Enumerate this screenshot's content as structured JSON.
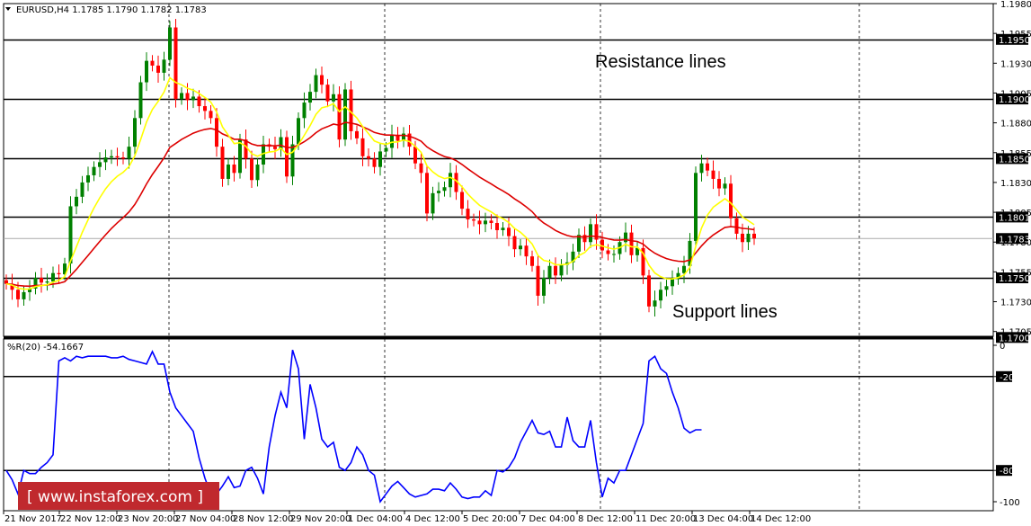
{
  "header": {
    "symbol_line": "EURUSD,H4  1.1785 1.1790 1.1782 1.1783"
  },
  "annotations": {
    "resistance": "Resistance lines",
    "support": "Support lines"
  },
  "watermark": {
    "text": "[ www.instaforex.com ]"
  },
  "colors": {
    "bull_candle": "#008000",
    "bear_candle": "#ff0000",
    "ma_fast": "#ffff00",
    "ma_slow": "#dd0000",
    "wpr_line": "#0000ff",
    "watermark_bg": "#c0292e"
  },
  "chart_data": [
    {
      "type": "candlestick",
      "title": "EURUSD,H4  1.1785 1.1790 1.1782 1.1783",
      "ylim": [
        1.1701,
        1.198
      ],
      "y_ticks": [
        1.198,
        1.1955,
        1.193,
        1.1905,
        1.188,
        1.1855,
        1.183,
        1.1805,
        1.178,
        1.1755,
        1.173,
        1.1705
      ],
      "y_tick_labels": [
        "1.1980",
        "1.1955",
        "1.1930",
        "1.1905",
        "1.1880",
        "1.1855",
        "1.1830",
        "1.1805",
        "1.1780",
        "1.1755",
        "1.1730",
        "1.1705"
      ],
      "x_tick_labels": [
        "21 Nov 2017",
        "22 Nov 12:00",
        "23 Nov 20:00",
        "27 Nov 04:00",
        "28 Nov 12:00",
        "29 Nov 20:00",
        "1 Dec 04:00",
        "4 Dec 12:00",
        "5 Dec 20:00",
        "7 Dec 04:00",
        "8 Dec 12:00",
        "11 Dec 20:00",
        "13 Dec 04:00",
        "14 Dec 12:00"
      ],
      "horizontal_lines": [
        {
          "value": 1.195,
          "label": "1.1950"
        },
        {
          "value": 1.19,
          "label": "1.1900"
        },
        {
          "value": 1.185,
          "label": "1.1850"
        },
        {
          "value": 1.1801,
          "label": "1.1801"
        },
        {
          "value": 1.175,
          "label": "1.1750"
        },
        {
          "value": 1.17,
          "label": "1.1700"
        }
      ],
      "current_price": {
        "value": 1.1783,
        "label": "1.1783"
      },
      "close": [
        1.1745,
        1.174,
        1.1732,
        1.1738,
        1.1741,
        1.175,
        1.1746,
        1.1747,
        1.1754,
        1.1753,
        1.1762,
        1.181,
        1.1818,
        1.183,
        1.1836,
        1.1843,
        1.1847,
        1.1851,
        1.1852,
        1.1851,
        1.185,
        1.186,
        1.1884,
        1.1914,
        1.1932,
        1.1928,
        1.1922,
        1.1933,
        1.196,
        1.19,
        1.1905,
        1.1899,
        1.1902,
        1.1894,
        1.189,
        1.1884,
        1.186,
        1.1833,
        1.1845,
        1.1838,
        1.1866,
        1.185,
        1.1832,
        1.1845,
        1.1862,
        1.186,
        1.1858,
        1.1868,
        1.1835,
        1.1862,
        1.1884,
        1.1897,
        1.1906,
        1.192,
        1.1912,
        1.1898,
        1.1904,
        1.1866,
        1.1908,
        1.1873,
        1.1867,
        1.1852,
        1.185,
        1.1843,
        1.1856,
        1.1859,
        1.187,
        1.1865,
        1.1871,
        1.186,
        1.1846,
        1.1838,
        1.1804,
        1.1821,
        1.1823,
        1.1826,
        1.1838,
        1.1822,
        1.1808,
        1.1799,
        1.1798,
        1.1795,
        1.1798,
        1.1796,
        1.179,
        1.1792,
        1.1785,
        1.1774,
        1.1777,
        1.1768,
        1.176,
        1.1735,
        1.175,
        1.176,
        1.1752,
        1.1761,
        1.1763,
        1.1772,
        1.1786,
        1.178,
        1.1795,
        1.1782,
        1.1773,
        1.177,
        1.177,
        1.178,
        1.1788,
        1.1769,
        1.1775,
        1.1752,
        1.1726,
        1.1731,
        1.174,
        1.1743,
        1.1749,
        1.1754,
        1.176,
        1.1781,
        1.1838,
        1.1846,
        1.184,
        1.1833,
        1.1825,
        1.1829,
        1.18,
        1.1787,
        1.178,
        1.1787,
        1.1783
      ]
    },
    {
      "type": "line",
      "title": "%R(20) -54.1667",
      "ylim": [
        -100,
        0
      ],
      "y_ticks": [
        0,
        -20,
        -80,
        -100
      ],
      "y_tick_labels": [
        "0",
        "-20",
        "-80",
        "-100"
      ],
      "level_lines": [
        -20,
        -80
      ],
      "series": [
        {
          "name": "%R(20)",
          "values": [
            -80,
            -86,
            -95,
            -80,
            -82,
            -82,
            -78,
            -75,
            -70,
            -10,
            -8,
            -10,
            -7,
            -8,
            -7,
            -7,
            -7,
            -7,
            -8,
            -8,
            -7,
            -9,
            -10,
            -11,
            -12,
            -4,
            -12,
            -12,
            -30,
            -40,
            -45,
            -50,
            -55,
            -72,
            -85,
            -95,
            -95,
            -90,
            -84,
            -91,
            -90,
            -80,
            -78,
            -85,
            -95,
            -65,
            -45,
            -30,
            -40,
            -3,
            -15,
            -60,
            -25,
            -40,
            -60,
            -65,
            -62,
            -78,
            -80,
            -75,
            -65,
            -70,
            -80,
            -83,
            -100,
            -95,
            -90,
            -87,
            -91,
            -95,
            -97,
            -96,
            -95,
            -92,
            -92,
            -93,
            -88,
            -92,
            -97,
            -98,
            -97,
            -97,
            -93,
            -96,
            -80,
            -81,
            -78,
            -72,
            -62,
            -55,
            -48,
            -56,
            -57,
            -55,
            -65,
            -65,
            -46,
            -61,
            -65,
            -65,
            -48,
            -75,
            -97,
            -85,
            -88,
            -80,
            -80,
            -70,
            -60,
            -50,
            -10,
            -7,
            -15,
            -18,
            -30,
            -40,
            -53,
            -56,
            -54,
            -54
          ]
        }
      ]
    }
  ]
}
